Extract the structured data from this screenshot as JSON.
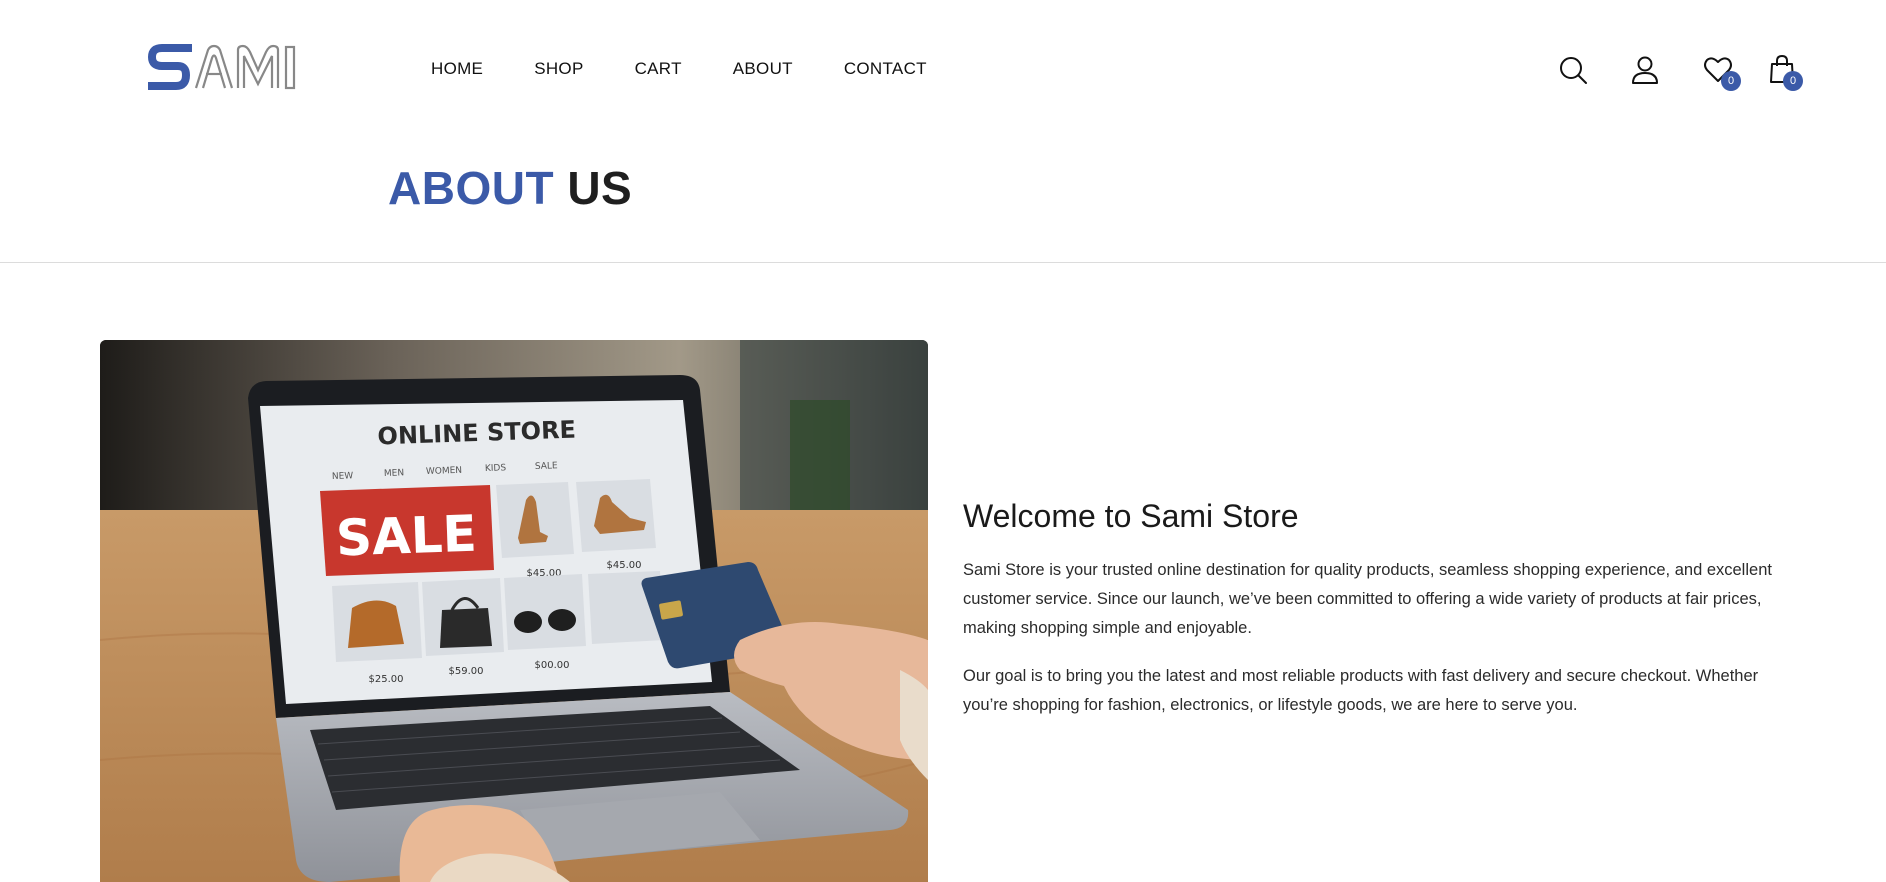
{
  "brand": {
    "logo_text": "SAMI",
    "accent_color": "#3b5aa8"
  },
  "nav": {
    "items": [
      {
        "label": "HOME"
      },
      {
        "label": "SHOP"
      },
      {
        "label": "CART"
      },
      {
        "label": "ABOUT"
      },
      {
        "label": "CONTACT"
      }
    ]
  },
  "header_icons": {
    "search": "search-icon",
    "account": "user-icon",
    "wishlist": "heart-icon",
    "cart": "shopping-bag-icon",
    "wishlist_count": "0",
    "cart_count": "0"
  },
  "page": {
    "title_accent": "ABOUT",
    "title_rest": "US"
  },
  "hero_image": {
    "screen_title": "ONLINE STORE",
    "screen_menu": [
      "NEW",
      "MEN",
      "WOMEN",
      "KIDS",
      "SALE"
    ],
    "sale_label": "SALE",
    "prices": [
      "$45.00",
      "$45.00",
      "$25.00",
      "$59.00",
      "$00.00"
    ]
  },
  "about": {
    "heading": "Welcome to Sami Store",
    "paragraph_1": "Sami Store is your trusted online destination for quality products, seamless shopping experience, and excellent customer service. Since our launch, we’ve been committed to offering a wide variety of products at fair prices, making shopping simple and enjoyable.",
    "paragraph_2": "Our goal is to bring you the latest and most reliable products with fast delivery and secure checkout. Whether you’re shopping for fashion, electronics, or lifestyle goods, we are here to serve you."
  }
}
